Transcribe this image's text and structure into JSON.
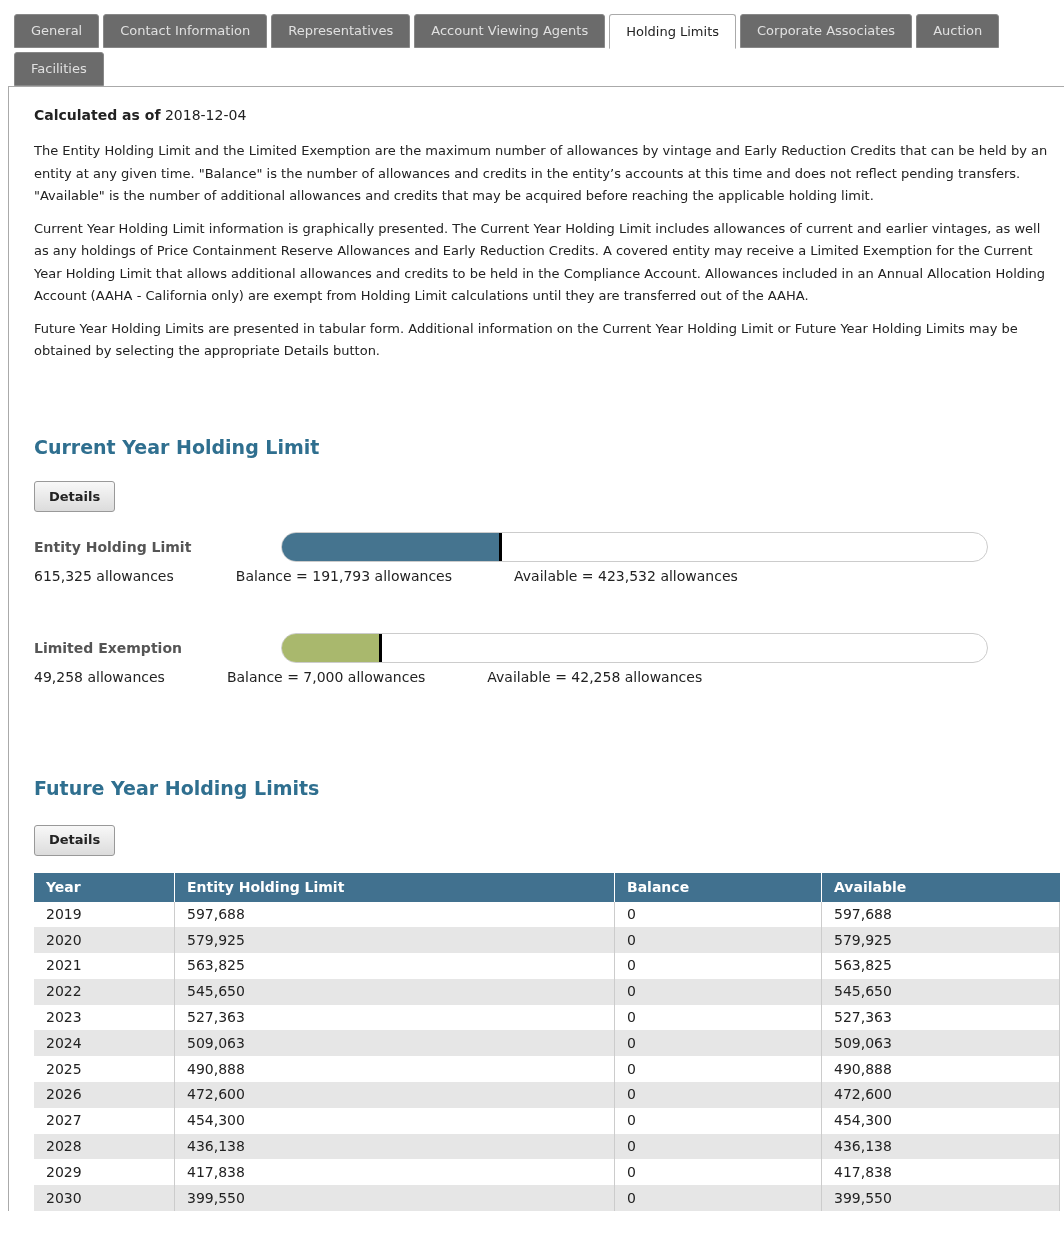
{
  "tabs": [
    {
      "label": "General",
      "selected": false
    },
    {
      "label": "Contact Information",
      "selected": false
    },
    {
      "label": "Representatives",
      "selected": false
    },
    {
      "label": "Account Viewing Agents",
      "selected": false
    },
    {
      "label": "Holding Limits",
      "selected": true
    },
    {
      "label": "Corporate Associates",
      "selected": false
    },
    {
      "label": "Auction",
      "selected": false
    },
    {
      "label": "Facilities",
      "selected": false
    }
  ],
  "calculated": {
    "label": "Calculated as of",
    "date": "2018-12-04"
  },
  "paragraphs": [
    "The Entity Holding Limit and the Limited Exemption are the maximum number of allowances by vintage and Early Reduction Credits that can be held by an entity at any given time. \"Balance\" is the number of allowances and credits in the entity’s accounts at this time and does not reflect pending transfers. \"Available\" is the number of additional allowances and credits that may be acquired before reaching the applicable holding limit.",
    "Current Year Holding Limit information is graphically presented. The Current Year Holding Limit includes allowances of current and earlier vintages, as well as any holdings of Price Containment Reserve Allowances and Early Reduction Credits. A covered entity may receive a Limited Exemption for the Current Year Holding Limit that allows additional allowances and credits to be held in the Compliance Account. Allowances included in an Annual Allocation Holding Account (AAHA - California only) are exempt from Holding Limit calculations until they are transferred out of the AAHA.",
    "Future Year Holding Limits are presented in tabular form. Additional information on the Current Year Holding Limit or Future Year Holding Limits may be obtained by selecting the appropriate Details button."
  ],
  "current": {
    "title": "Current Year Holding Limit",
    "button": "Details",
    "limits": [
      {
        "label": "Entity Holding Limit",
        "total": "615,325 allowances",
        "balance": "Balance = 191,793 allowances",
        "available": "Available = 423,532 allowances",
        "level": 0.312,
        "color": "#45748f"
      },
      {
        "label": "Limited Exemption",
        "total": "49,258 allowances",
        "balance": "Balance = 7,000 allowances",
        "available": "Available = 42,258 allowances",
        "level": 0.142,
        "color": "#a9b86d"
      }
    ]
  },
  "future": {
    "title": "Future Year Holding Limits",
    "button": "Details",
    "table": {
      "columns": [
        "Year",
        "Entity Holding Limit",
        "Balance",
        "Available"
      ],
      "rows": [
        [
          "2019",
          "597,688",
          "0",
          "597,688"
        ],
        [
          "2020",
          "579,925",
          "0",
          "579,925"
        ],
        [
          "2021",
          "563,825",
          "0",
          "563,825"
        ],
        [
          "2022",
          "545,650",
          "0",
          "545,650"
        ],
        [
          "2023",
          "527,363",
          "0",
          "527,363"
        ],
        [
          "2024",
          "509,063",
          "0",
          "509,063"
        ],
        [
          "2025",
          "490,888",
          "0",
          "490,888"
        ],
        [
          "2026",
          "472,600",
          "0",
          "472,600"
        ],
        [
          "2027",
          "454,300",
          "0",
          "454,300"
        ],
        [
          "2028",
          "436,138",
          "0",
          "436,138"
        ],
        [
          "2029",
          "417,838",
          "0",
          "417,838"
        ],
        [
          "2030",
          "399,550",
          "0",
          "399,550"
        ]
      ]
    }
  }
}
